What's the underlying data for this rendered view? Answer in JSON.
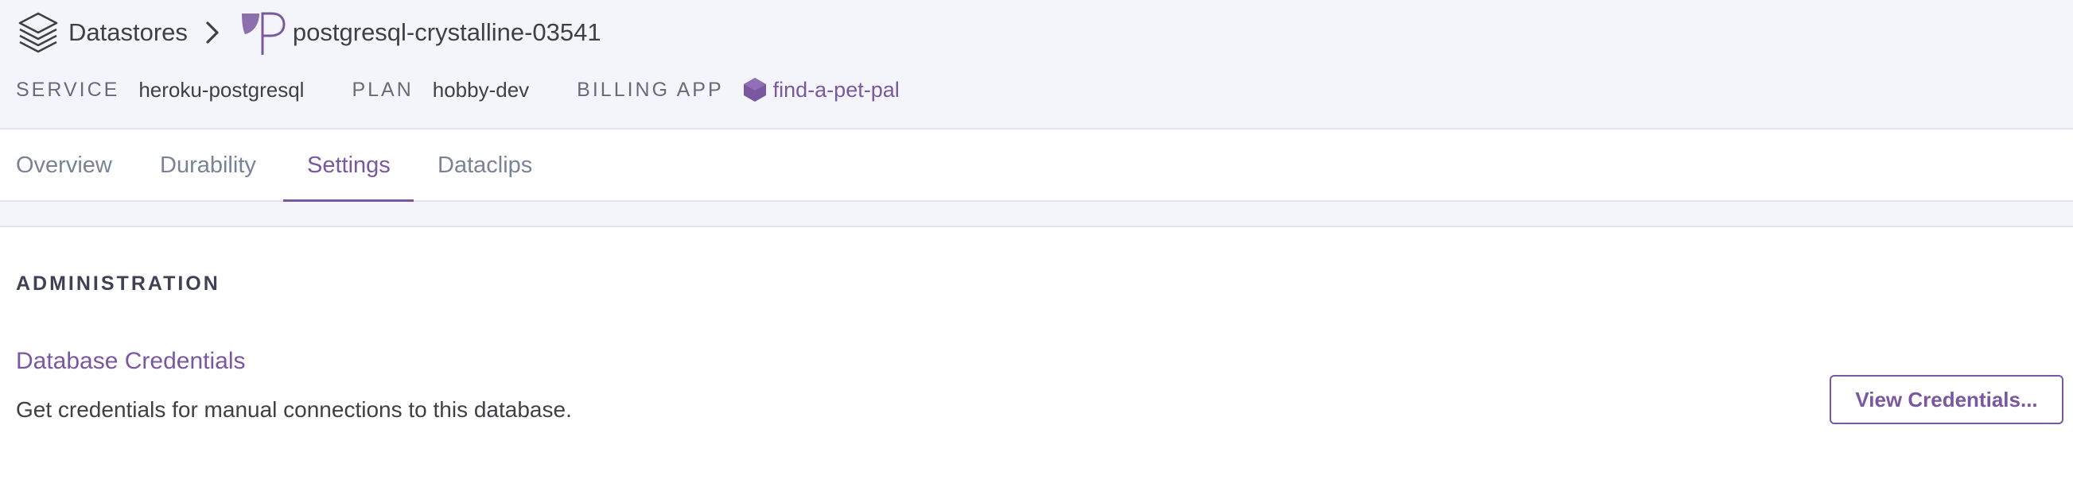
{
  "breadcrumb": {
    "root_label": "Datastores",
    "root_icon": "layers-stack-icon",
    "separator_icon": "chevron-right-icon",
    "resource_icon": "postgres-icon",
    "resource_name": "postgresql-crystalline-03541"
  },
  "meta": {
    "service_label": "SERVICE",
    "service_value": "heroku-postgresql",
    "plan_label": "PLAN",
    "plan_value": "hobby-dev",
    "billing_label": "BILLING APP",
    "billing_icon": "app-hexagon-icon",
    "billing_value": "find-a-pet-pal"
  },
  "tabs": [
    {
      "label": "Overview",
      "active": false
    },
    {
      "label": "Durability",
      "active": false
    },
    {
      "label": "Settings",
      "active": true
    },
    {
      "label": "Dataclips",
      "active": false
    }
  ],
  "administration": {
    "heading": "ADMINISTRATION",
    "item_title": "Database Credentials",
    "item_description": "Get credentials for manual connections to this database.",
    "button_label": "View Credentials..."
  },
  "colors": {
    "accent": "#79589f",
    "header_bg": "#f4f5fa",
    "text": "#3f3f44",
    "muted_text": "#7c8295"
  }
}
